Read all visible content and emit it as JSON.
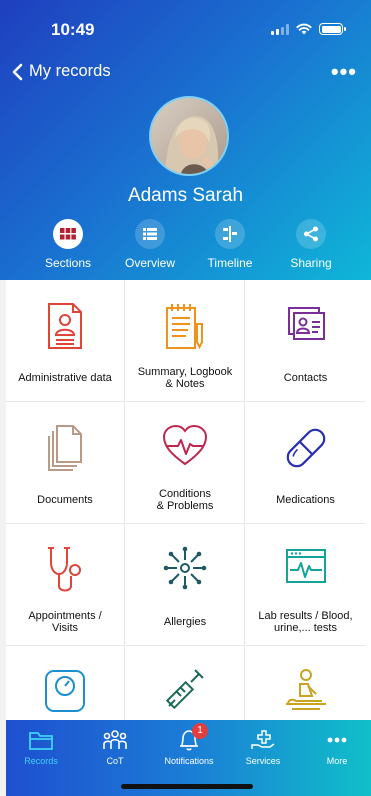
{
  "status_bar": {
    "time": "10:49"
  },
  "nav": {
    "back_label": "My records",
    "more_glyph": "•••"
  },
  "profile": {
    "name": "Adams Sarah"
  },
  "tabs": [
    {
      "label": "Sections",
      "icon": "grid-icon",
      "active": true
    },
    {
      "label": "Overview",
      "icon": "list-icon",
      "active": false
    },
    {
      "label": "Timeline",
      "icon": "timeline-icon",
      "active": false
    },
    {
      "label": "Sharing",
      "icon": "share-icon",
      "active": false
    }
  ],
  "sections": [
    {
      "label": "Administrative data",
      "icon": "id-card-icon",
      "color": "#e0453a"
    },
    {
      "label": "Summary, Logbook\n& Notes",
      "icon": "notepad-icon",
      "color": "#f0931c"
    },
    {
      "label": "Contacts",
      "icon": "contacts-icon",
      "color": "#7a2f98"
    },
    {
      "label": "Documents",
      "icon": "documents-icon",
      "color": "#b99a86"
    },
    {
      "label": "Conditions\n& Problems",
      "icon": "heart-pulse-icon",
      "color": "#c0274e"
    },
    {
      "label": "Medications",
      "icon": "pill-icon",
      "color": "#2a2fb0"
    },
    {
      "label": "Appointments /\nVisits",
      "icon": "stethoscope-icon",
      "color": "#e0453a"
    },
    {
      "label": "Allergies",
      "icon": "allergen-icon",
      "color": "#1f5964"
    },
    {
      "label": "Lab results / Blood,\nurine,... tests",
      "icon": "lab-monitor-icon",
      "color": "#14a39a"
    },
    {
      "label": "",
      "icon": "scale-icon",
      "color": "#1b8fd0"
    },
    {
      "label": "",
      "icon": "syringe-icon",
      "color": "#1e6b55"
    },
    {
      "label": "",
      "icon": "cpr-icon",
      "color": "#c9a321"
    }
  ],
  "bottom_nav": [
    {
      "label": "Records",
      "icon": "folder-icon",
      "active": true
    },
    {
      "label": "CoT",
      "icon": "people-icon",
      "active": false
    },
    {
      "label": "Notifications",
      "icon": "bell-icon",
      "active": false,
      "badge": "1"
    },
    {
      "label": "Services",
      "icon": "hand-cross-icon",
      "active": false
    },
    {
      "label": "More",
      "icon": "more-icon",
      "active": false
    }
  ],
  "colors": {
    "header_start": "#1f3fbf",
    "header_end": "#0fb7d8",
    "active_tab_icon": "#b3202f",
    "active_bottom": "#3fd4f5",
    "badge": "#e43d3d"
  }
}
